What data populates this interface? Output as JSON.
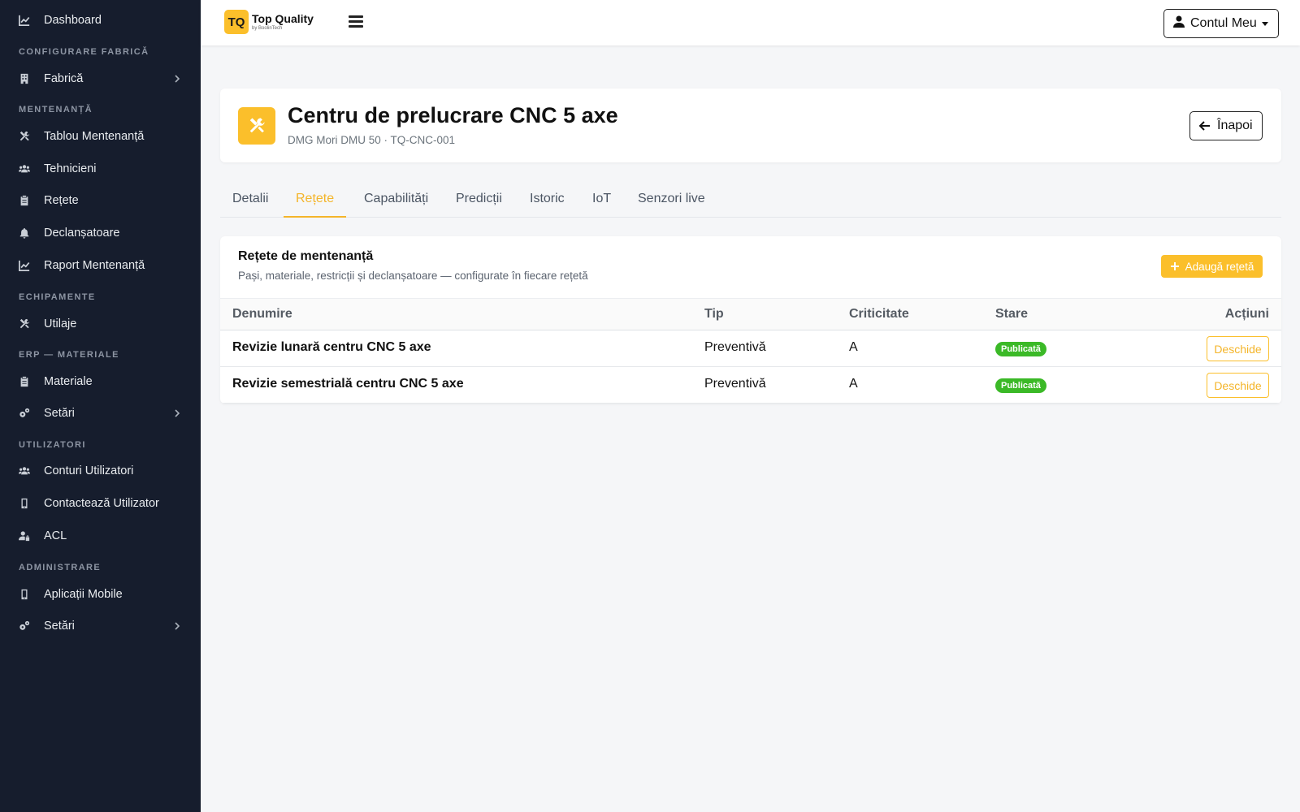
{
  "sidebar": {
    "items": {
      "dashboard": "Dashboard",
      "fabrica": "Fabrică",
      "tablou": "Tablou Mentenanță",
      "tehnicieni": "Tehnicieni",
      "retete": "Rețete",
      "declansatoare": "Declanșatoare",
      "raport": "Raport Mentenanță",
      "utilaje": "Utilaje",
      "materiale": "Materiale",
      "setari_erp": "Setări",
      "conturi": "Conturi Utilizatori",
      "contacteaza": "Contactează Utilizator",
      "acl": "ACL",
      "aplicatii": "Aplicații Mobile",
      "setari_admin": "Setări"
    },
    "headings": {
      "configurare": "CONFIGURARE FABRICĂ",
      "mentenanta": "MENTENANȚĂ",
      "echipamente": "ECHIPAMENTE",
      "erp": "ERP — MATERIALE",
      "utilizatori": "UTILIZATORI",
      "administrare": "ADMINISTRARE"
    }
  },
  "topbar": {
    "logo_mark": "TQ",
    "logo_name": "Top Quality",
    "logo_sub": "by BoolinTech",
    "account_label": "Contul Meu"
  },
  "header": {
    "title": "Centru de prelucrare CNC 5 axe",
    "subtitle": "DMG Mori DMU 50 · TQ-CNC-001",
    "back_label": "Înapoi"
  },
  "tabs": [
    "Detalii",
    "Rețete",
    "Capabilități",
    "Predicții",
    "Istoric",
    "IoT",
    "Senzori live"
  ],
  "active_tab": "Rețete",
  "recipes": {
    "title": "Rețete de mentenanță",
    "subtitle": "Pași, materiale, restricții și declanșatoare — configurate în fiecare rețetă",
    "add_label": "Adaugă rețetă",
    "columns": [
      "Denumire",
      "Tip",
      "Criticitate",
      "Stare",
      "Acțiuni"
    ],
    "rows": [
      {
        "name": "Revizie lunară centru CNC 5 axe",
        "type": "Preventivă",
        "criticality": "A",
        "status": "Publicată",
        "action": "Deschide"
      },
      {
        "name": "Revizie semestrială centru CNC 5 axe",
        "type": "Preventivă",
        "criticality": "A",
        "status": "Publicată",
        "action": "Deschide"
      }
    ]
  },
  "colors": {
    "sidebar_bg": "#161d2d",
    "accent": "#fbbf2b",
    "status_published": "#3bb927"
  }
}
